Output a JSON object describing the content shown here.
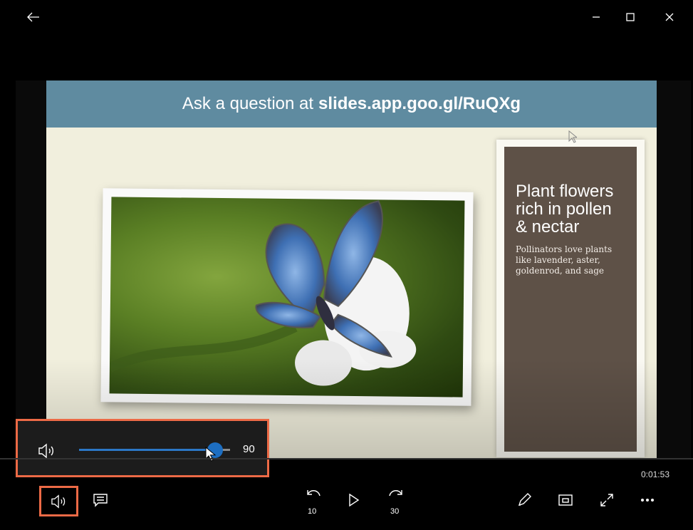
{
  "slide": {
    "banner_prefix": "Ask a question at",
    "banner_url": "slides.app.goo.gl/RuQXg",
    "caption_title": "Plant flowers rich in pollen & nectar",
    "caption_text": "Pollinators love plants like lavender, aster, goldenrod, and sage"
  },
  "volume": {
    "value_label": "90",
    "level": 0.9
  },
  "playback": {
    "elapsed": "0:01:53",
    "skip_back_label": "10",
    "skip_forward_label": "30"
  },
  "colors": {
    "highlight": "#ec6a46",
    "accent": "#1d6ec1",
    "banner": "#5f8ba0",
    "caption_panel": "#5e5147"
  },
  "icons": {
    "back": "arrow-left-icon",
    "minimize": "minimize-icon",
    "maximize": "maximize-icon",
    "close": "close-icon",
    "volume": "speaker-icon",
    "captions": "captions-icon",
    "skip_back": "skip-back-10-icon",
    "play": "play-icon",
    "skip_forward": "skip-forward-30-icon",
    "pen": "pen-icon",
    "mini_view": "mini-view-icon",
    "fullscreen": "fullscreen-icon",
    "more": "more-icon"
  }
}
